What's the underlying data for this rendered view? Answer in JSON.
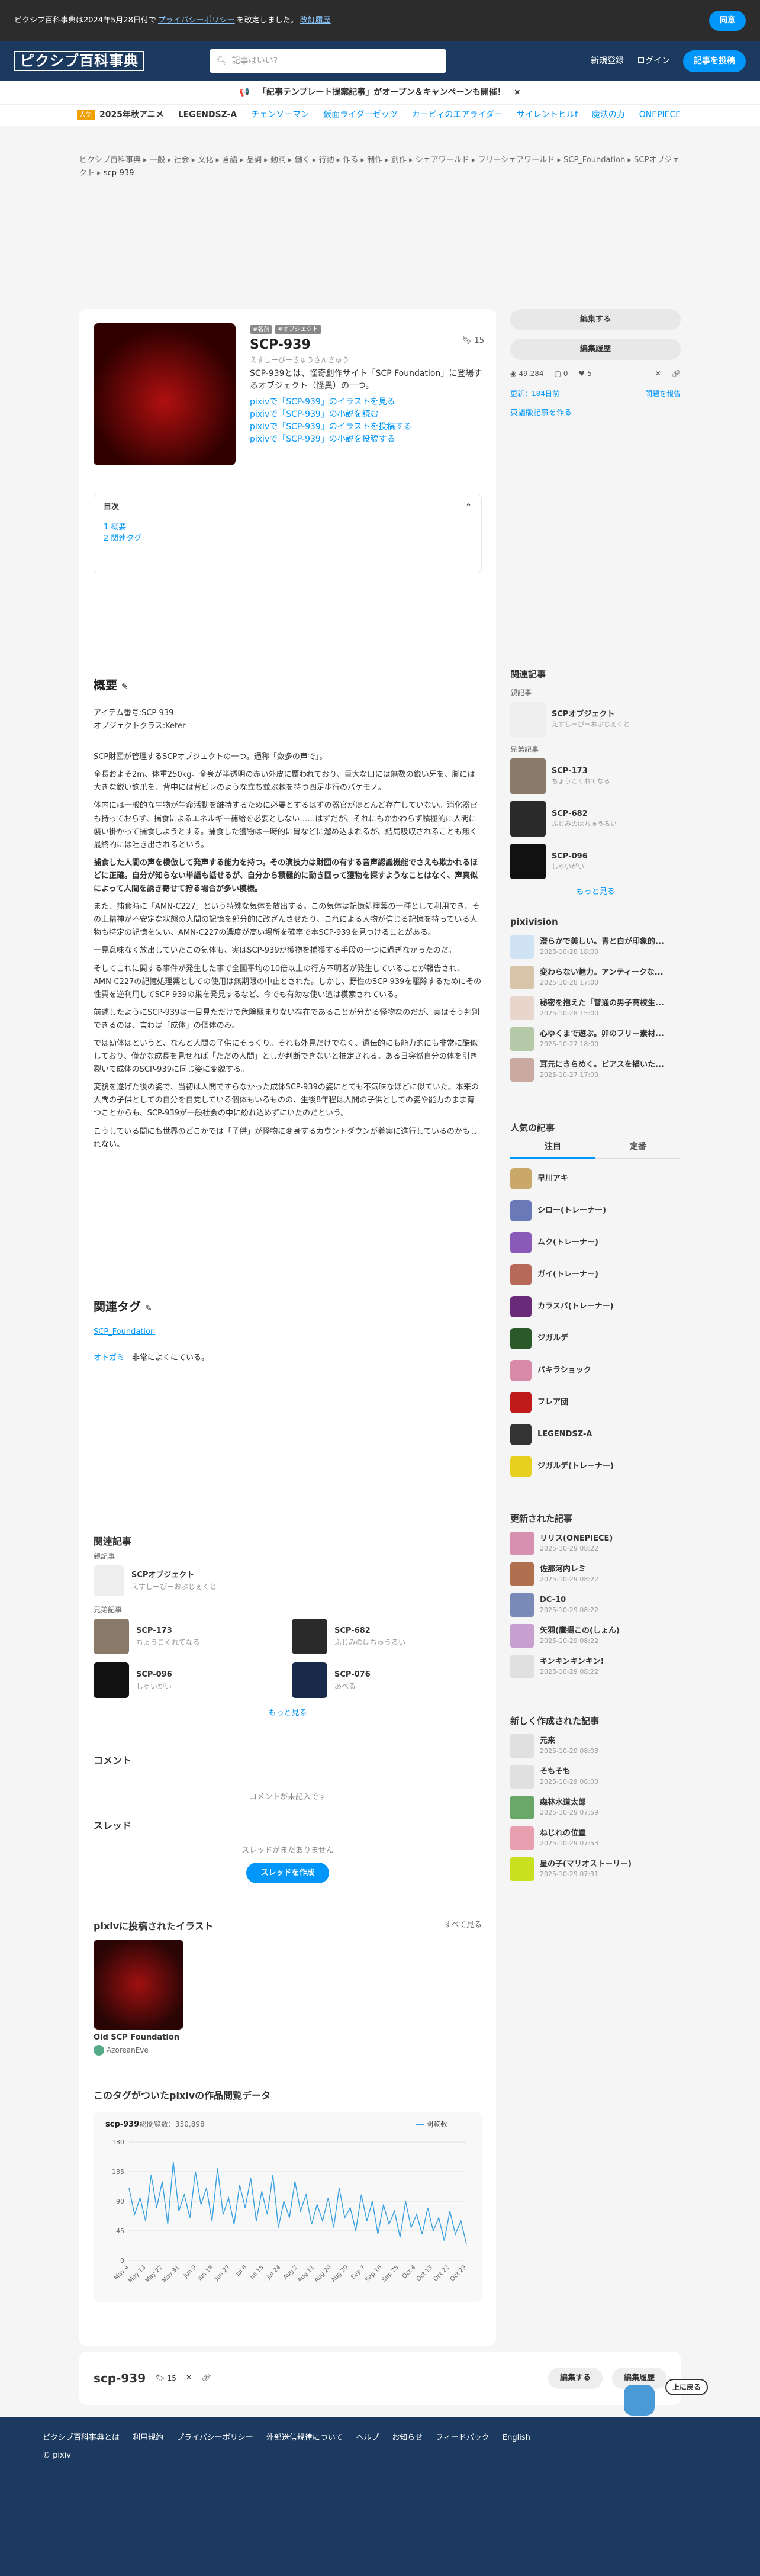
{
  "notice": {
    "text": "ピクシブ百科事典は2024年5月28日付で",
    "link": "プライバシーポリシー",
    "text2": "を改定しました。",
    "link2": "改訂履歴",
    "agree": "同意"
  },
  "header": {
    "logo": "ピクシブ百科事典",
    "search_placeholder": "記事はいい?",
    "register": "新規登録",
    "login": "ログイン",
    "post": "記事を投稿"
  },
  "banner": {
    "text": "「記事テンプレート提案記事」がオープン＆キャンペーンも開催！",
    "close": "×"
  },
  "tagbar": {
    "hot": "人気",
    "items": [
      "2025年秋アニメ",
      "LEGENDSZ-A",
      "チェンソーマン",
      "仮面ライダーゼッツ",
      "カービィのエアライダー",
      "サイレントヒルf",
      "魔法の力",
      "ONEPIECE"
    ]
  },
  "breadcrumb": [
    "ピクシブ百科事典",
    "一般",
    "社会",
    "文化",
    "言語",
    "品詞",
    "動詞",
    "働く",
    "行動",
    "作る",
    "制作",
    "創作",
    "シェアワールド",
    "フリーシェアワールド",
    "SCP_Foundation",
    "SCPオブジェクト",
    "scp-939"
  ],
  "article": {
    "badges": [
      "#名前",
      "#オブジェクト"
    ],
    "title": "SCP-939",
    "reading": "えすしーぴーきゅうさんきゅう",
    "bookmarks": "15",
    "summary": "SCP-939とは、怪奇創作サイト「SCP Foundation」に登場するオブジェクト（怪異）の一つ。",
    "links": [
      "pixivで「SCP-939」のイラストを見る",
      "pixivで「SCP-939」の小説を読む",
      "pixivで「SCP-939」のイラストを投稿する",
      "pixivで「SCP-939」の小説を投稿する"
    ],
    "toc": {
      "title": "目次",
      "items": [
        "1 概要",
        "2 関連タグ"
      ]
    },
    "overview_h": "概要",
    "item_no": "アイテム番号:SCP-939",
    "item_class": "オブジェクトクラス:Keter",
    "paras": [
      "SCP財団が管理するSCPオブジェクトの一つ。通称「数多の声で」。",
      "全長およそ2m、体重250kg。全身が半透明の赤い外皮に覆われており、巨大な口には無数の鋭い牙を、脚には大きな鋭い鉤爪を、背中には背ビレのような立ち並ぶ棘を持つ四足歩行のバケモノ。",
      "体内には一般的な生物が生命活動を維持するために必要とするはずの器官がほとんど存在していない。消化器官も持っておらず、捕食によるエネルギー補給を必要としない……はずだが、それにもかかわらず積極的に人間に襲い掛かって捕食しようとする。捕食した獲物は一時的に胃などに溜め込まれるが、結局吸収されることも無く最終的には吐き出されるという。",
      "捕食した人間の声を模倣して発声する能力を持つ。その演技力は財団の有する音声認識機能でさえも欺かれるほどに正確。自分が知らない単語も話せるが、自分から積極的に動き回って獲物を探すようなことはなく、声真似によって人間を誘き寄せて狩る場合が多い模様。",
      "また、捕食時に「AMN-C227」という特殊な気体を放出する。この気体は記憶処理薬の一種として利用でき、その上精神が不安定な状態の人間の記憶を部分的に改ざんさせたり、これによる人物が信じる記憶を持っている人物も特定の記憶を失い、AMN-C227の濃度が高い場所を確率で本SCP-939を見つけることがある。",
      "一見意味なく放出していたこの気体も、実はSCP-939が獲物を捕獲する手段の一つに過ぎなかったのだ。",
      "そしてこれに関する事件が発生した事で全国平均の10倍以上の行方不明者が発生していることが報告され、AMN-C227の記憶処理薬としての使用は無期限の中止とされた。しかし、野性のSCP-939を駆除するためにその性質を逆利用してSCP-939の巣を発見するなど、今でも有効な使い道は模索されている。",
      "前述したようにSCP-939は一目見ただけで危険極まりない存在であることが分かる怪物なのだが、実はそう判別できるのは、言わば「成体」の個体のみ。",
      "では幼体はというと、なんと人間の子供にそっくり。それも外見だけでなく、遺伝的にも能力的にも非常に酷似しており、僅かな成長を見せれば「ただの人間」としか判断できないと推定される。ある日突然自分の体を引き裂いて成体のSCP-939に同じ姿に変貌する。",
      "変貌を遂げた後の姿で、当初は人間ですらなかった成体SCP-939の姿にとても不気味なほどに似ていた。本来の人間の子供としての自分を自覚している個体もいるものの、生後8年程は人間の子供としての姿や能力のまま育つことからも、SCP-939が一般社会の中に紛れ込めずにいたのだという。",
      "こうしている間にも世界のどこかでは「子供」が怪物に変身するカウントダウンが着実に進行しているのかもしれない。"
    ],
    "related_h": "関連タグ",
    "related_tags": [
      "SCP_Foundation"
    ],
    "see_also": "オトガミ",
    "see_also_note": "非常によくにている。",
    "related_articles_h": "関連記事",
    "parent_label": "親記事",
    "parent": {
      "title": "SCPオブジェクト",
      "sub": "えすしーぴーおぶじぇくと"
    },
    "sibling_label": "兄弟記事",
    "siblings": [
      {
        "title": "SCP-173",
        "sub": "ちょうこくれてなる"
      },
      {
        "title": "SCP-682",
        "sub": "ふじみのはちゅうるい"
      },
      {
        "title": "SCP-096",
        "sub": "しゃいがい"
      },
      {
        "title": "SCP-076",
        "sub": "あべる"
      }
    ],
    "more": "もっと見る",
    "comment_h": "コメント",
    "comment_empty": "コメントが未記入です",
    "thread_h": "スレッド",
    "thread_empty": "スレッドがまだありません",
    "thread_create": "スレッドを作成",
    "illust_h": "pixivに投稿されたイラスト",
    "illust_all": "すべて見る",
    "illust": {
      "title": "Old SCP Foundation",
      "user": "AzoreanEve"
    },
    "views_h": "このタグがついたpixivの作品閲覧データ"
  },
  "sidebar": {
    "edit": "編集する",
    "history": "編集履歴",
    "stats": {
      "views": "49,284",
      "comments": "0",
      "likes": "5"
    },
    "updated": "更新：184日前",
    "report": "問題を報告",
    "create_english": "英語版記事を作る",
    "related_h": "関連記事",
    "parent_label": "親記事",
    "parent": "SCPオブジェクト",
    "parent_sub": "えすしーぴーおぶじぇくと",
    "sibling_label": "兄弟記事",
    "siblings": [
      {
        "t": "SCP-173",
        "s": "ちょうこくれてなる"
      },
      {
        "t": "SCP-682",
        "s": "ふじみのはちゅうるい"
      },
      {
        "t": "SCP-096",
        "s": "しゃいがい"
      }
    ],
    "more": "もっと見る",
    "pixivision_h": "pixivision",
    "pixivision": [
      {
        "t": "澄らかで美しい。青と白が印象的...",
        "d": "2025-10-28 18:00"
      },
      {
        "t": "変わらない魅力。アンティークな...",
        "d": "2025-10-28 17:00"
      },
      {
        "t": "秘密を抱えた「普通の男子高校生...",
        "d": "2025-10-28 15:00"
      },
      {
        "t": "心ゆくまで遊ぶ。卯のフリー素材...",
        "d": "2025-10-27 18:00"
      },
      {
        "t": "耳元にきらめく。ピアスを描いた...",
        "d": "2025-10-27 17:00"
      }
    ],
    "popular_h": "人気の記事",
    "tab_attention": "注目",
    "tab_regular": "定番",
    "popular": [
      "早川アキ",
      "シロー(トレーナー)",
      "ムク(トレーナー)",
      "ガイ(トレーナー)",
      "カラスバ(トレーナー)",
      "ジガルデ",
      "パキラショック",
      "フレア団",
      "LEGENDSZ-A",
      "ジガルデ(トレーナー)"
    ],
    "updated_h": "更新された記事",
    "updated_list": [
      {
        "t": "リリス(ONEPIECE)",
        "d": "2025-10-29 08:22"
      },
      {
        "t": "佐那河内レミ",
        "d": "2025-10-29 08:22"
      },
      {
        "t": "DC-10",
        "d": "2025-10-29 08:22"
      },
      {
        "t": "矢羽(鷹揚この(しょん)",
        "d": "2025-10-29 08:22"
      },
      {
        "t": "キンキンキンキン!",
        "d": "2025-10-29 08:22"
      }
    ],
    "new_h": "新しく作成された記事",
    "new_list": [
      {
        "t": "元来",
        "d": "2025-10-29 08:03"
      },
      {
        "t": "そもそも",
        "d": "2025-10-29 08:00"
      },
      {
        "t": "森林水道太郎",
        "d": "2025-10-29 07:59"
      },
      {
        "t": "ねじれの位置",
        "d": "2025-10-29 07:53"
      },
      {
        "t": "星の子(マリオストーリー)",
        "d": "2025-10-29 07:31"
      }
    ]
  },
  "footbar": {
    "title": "scp-939",
    "count": "15",
    "edit": "編集する",
    "history": "編集履歴"
  },
  "scroll_top": "上に戻る",
  "footer": {
    "links": [
      "ピクシブ百科事典とは",
      "利用規約",
      "プライバシーポリシー",
      "外部送信規律について",
      "ヘルプ",
      "お知らせ",
      "フィードバック",
      "English"
    ],
    "copyright": "© pixiv"
  },
  "chart_data": {
    "type": "line",
    "title": "scp-939",
    "subtitle": "総閲覧数：350,898",
    "legend": "閲覧数",
    "ylim": [
      0,
      180
    ],
    "yticks": [
      0,
      45,
      90,
      135,
      180
    ],
    "categories": [
      "May 4",
      "May 13",
      "May 22",
      "May 31",
      "Jun 9",
      "Jun 18",
      "Jun 27",
      "Jul 6",
      "Jul 15",
      "Jul 24",
      "Aug 2",
      "Aug 11",
      "Aug 20",
      "Aug 29",
      "Sep 7",
      "Sep 16",
      "Sep 25",
      "Oct 4",
      "Oct 13",
      "Oct 22",
      "Oct 29"
    ],
    "values": [
      110,
      70,
      95,
      60,
      130,
      80,
      120,
      55,
      150,
      75,
      100,
      65,
      135,
      85,
      110,
      60,
      140,
      70,
      95,
      55,
      115,
      80,
      125,
      60,
      105,
      70,
      130,
      50,
      90,
      65,
      120,
      75,
      100,
      55,
      85,
      60,
      95,
      50,
      110,
      65,
      80,
      45,
      100,
      60,
      90,
      40,
      85,
      55,
      75,
      35,
      90,
      50,
      70,
      40,
      80,
      45,
      65,
      30,
      75,
      40,
      60,
      25
    ]
  }
}
